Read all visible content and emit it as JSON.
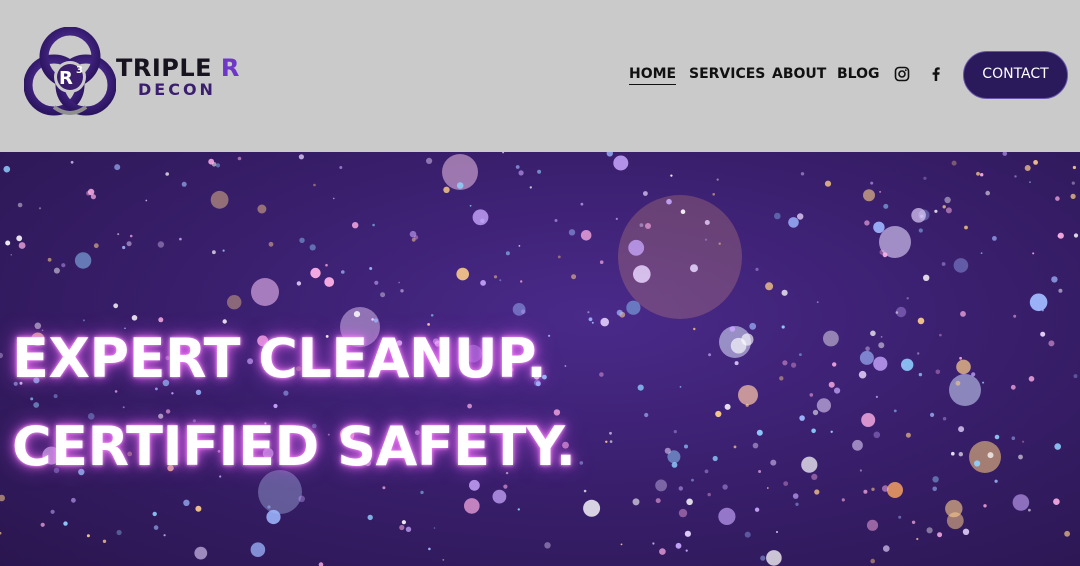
{
  "brand": {
    "logo_mark_text": "R",
    "logo_mark_sup": "3",
    "name_part1": "TRIPLE ",
    "name_part2": "R",
    "subname": "DECON"
  },
  "nav": {
    "items": [
      {
        "label": "HOME",
        "active": true
      },
      {
        "label": "SERVICES",
        "active": false
      },
      {
        "label": "ABOUT",
        "active": false
      },
      {
        "label": "BLOG",
        "active": false
      }
    ],
    "social_icons": [
      "instagram-icon",
      "facebook-icon"
    ],
    "contact_label": "CONTACT"
  },
  "hero": {
    "line1": "EXPERT CLEANUP.",
    "line2": "CERTIFIED SAFETY."
  },
  "colors": {
    "header_bg": "#cacaca",
    "brand_purple": "#3b1f6e",
    "button_bg": "#2a1a5c",
    "glow": "#ff78ff"
  }
}
